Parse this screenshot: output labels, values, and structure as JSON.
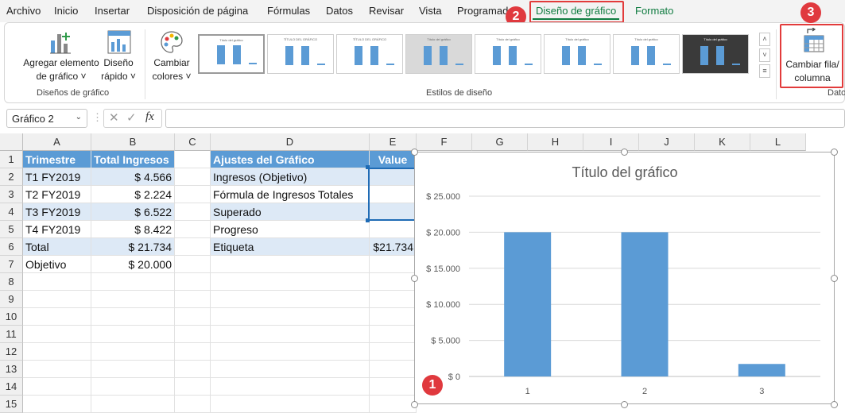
{
  "menu": {
    "items": [
      "Archivo",
      "Inicio",
      "Insertar",
      "Disposición de página",
      "Fórmulas",
      "Datos",
      "Revisar",
      "Vista",
      "Programador"
    ],
    "active_tab": "Diseño de gráfico",
    "format_tab": "Formato"
  },
  "ribbon": {
    "add_element": {
      "line1": "Agregar elemento",
      "line2": "de gráfico ˅"
    },
    "quick_layout": {
      "line1": "Diseño",
      "line2": "rápido ˅"
    },
    "change_colors": {
      "line1": "Cambiar",
      "line2": "colores ˅"
    },
    "group_layouts": "Diseños de gráfico",
    "group_styles": "Estilos de diseño",
    "switch_row_col": {
      "line1": "Cambiar fila/",
      "line2": "columna"
    },
    "group_data": "Datos",
    "style_titles": [
      "Título del gráfico",
      "TÍTULO DEL GRÁFICO",
      "TÍTULO DEL GRÁFICO",
      "Título del gráfico",
      "Título del gráfico",
      "Título del gráfico",
      "Título del gráfico",
      "Título del gráfico"
    ]
  },
  "formula_bar": {
    "name_box": "Gráfico 2",
    "formula": ""
  },
  "columns": [
    "A",
    "B",
    "C",
    "D",
    "E",
    "F",
    "G",
    "H",
    "I",
    "J",
    "K",
    "L"
  ],
  "rows": [
    "1",
    "2",
    "3",
    "4",
    "5",
    "6",
    "7",
    "8",
    "9",
    "10",
    "11",
    "12",
    "13",
    "14",
    "15"
  ],
  "cells": {
    "A1": "Trimestre",
    "B1": "Total Ingresos",
    "A2": "T1 FY2019",
    "B2": "$ 4.566",
    "A3": "T2 FY2019",
    "B3": "$ 2.224",
    "A4": "T3 FY2019",
    "B4": "$ 6.522",
    "A5": "T4 FY2019",
    "B5": "$ 8.422",
    "A6": "Total",
    "B6": "$ 21.734",
    "A7": "Objetivo",
    "B7": "$ 20.000",
    "D1": "Ajustes del Gráfico",
    "E1": "Value",
    "D2": "Ingresos (Objetivo)",
    "D3": "Fórmula de Ingresos Totales",
    "D4": "Superado",
    "D5": "Progreso",
    "D6": "Etiqueta",
    "E6": "$21.734"
  },
  "badges": {
    "one": "1",
    "two": "2",
    "three": "3"
  },
  "colors": {
    "excel_green": "#107c41",
    "bar_blue": "#5b9bd5",
    "header_blue": "#5b9bd5",
    "band_blue": "#dde9f6",
    "badge_red": "#e0393e"
  },
  "chart_data": {
    "type": "bar",
    "title": "Título del gráfico",
    "categories": [
      "1",
      "2",
      "3"
    ],
    "values": [
      20000,
      20000,
      1734
    ],
    "ylim": [
      0,
      25000
    ],
    "yticks": [
      "$ 0",
      "$ 5.000",
      "$ 10.000",
      "$ 15.000",
      "$ 20.000",
      "$ 25.000"
    ],
    "ytick_values": [
      0,
      5000,
      10000,
      15000,
      20000,
      25000
    ],
    "grid": true,
    "legend": "none"
  }
}
